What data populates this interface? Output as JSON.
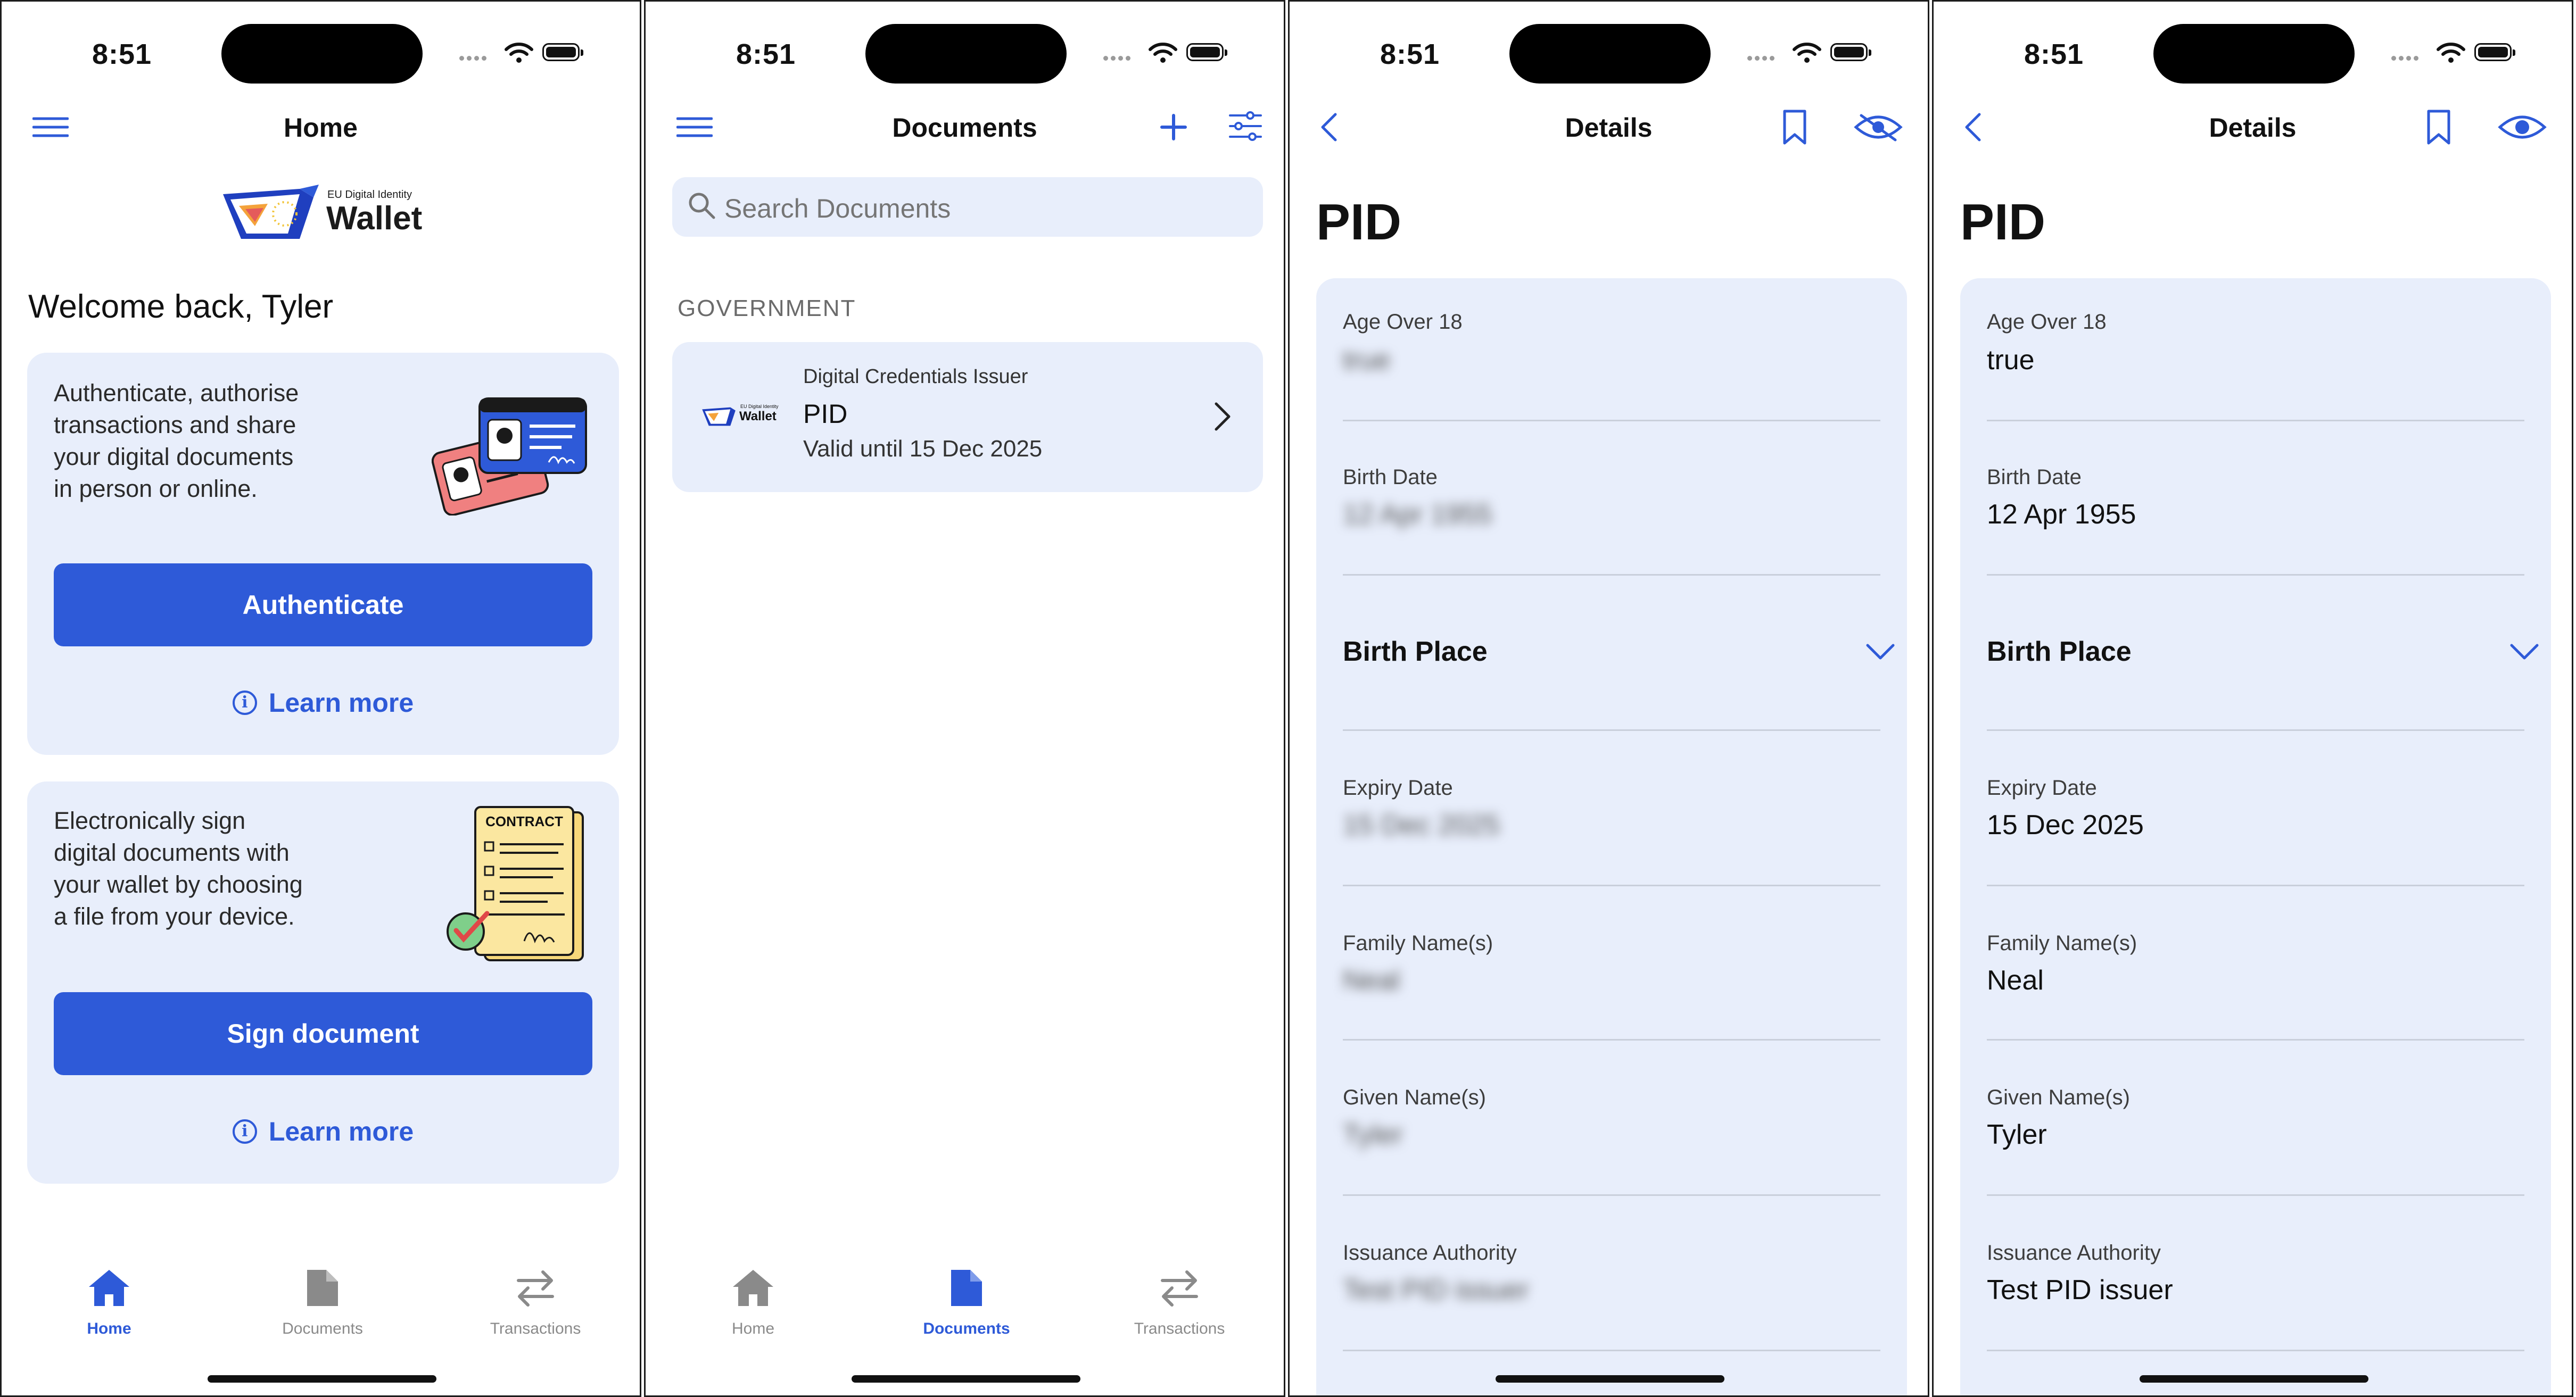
{
  "status": {
    "time": "8:51"
  },
  "home": {
    "title": "Home",
    "logo_small": "EU Digital Identity",
    "logo_big": "Wallet",
    "welcome": "Welcome back, Tyler",
    "auth_card": {
      "text_lines": [
        "Authenticate, authorise",
        "transactions and share",
        "your digital documents",
        "in person or online."
      ],
      "button": "Authenticate",
      "learn_more": "Learn more"
    },
    "sign_card": {
      "text_lines": [
        "Electronically sign",
        "digital documents with",
        "your wallet by choosing",
        "a file from your device."
      ],
      "contract_label": "CONTRACT",
      "button": "Sign document",
      "learn_more": "Learn more"
    }
  },
  "documents": {
    "title": "Documents",
    "search_placeholder": "Search Documents",
    "section": "GOVERNMENT",
    "item": {
      "issuer": "Digital Credentials Issuer",
      "name": "PID",
      "validity": "Valid until 15 Dec 2025",
      "logo_small": "EU Digital Identity",
      "logo_big": "Wallet"
    }
  },
  "details": {
    "title": "Details",
    "heading": "PID",
    "fields": [
      {
        "label": "Age Over 18",
        "value": "true"
      },
      {
        "label": "Birth Date",
        "value": "12 Apr 1955"
      },
      {
        "label": "Birth Place",
        "value": ""
      },
      {
        "label": "Expiry Date",
        "value": "15 Dec 2025"
      },
      {
        "label": "Family Name(s)",
        "value": "Neal"
      },
      {
        "label": "Given Name(s)",
        "value": "Tyler"
      },
      {
        "label": "Issuance Authority",
        "value": "Test PID issuer"
      }
    ]
  },
  "tabs": [
    {
      "label": "Home",
      "icon": "house-icon"
    },
    {
      "label": "Documents",
      "icon": "document-icon"
    },
    {
      "label": "Transactions",
      "icon": "arrows-icon"
    }
  ],
  "colors": {
    "accent": "#2e5ad8",
    "card_bg": "#e8eefb",
    "separator": "#c9cfdb"
  }
}
